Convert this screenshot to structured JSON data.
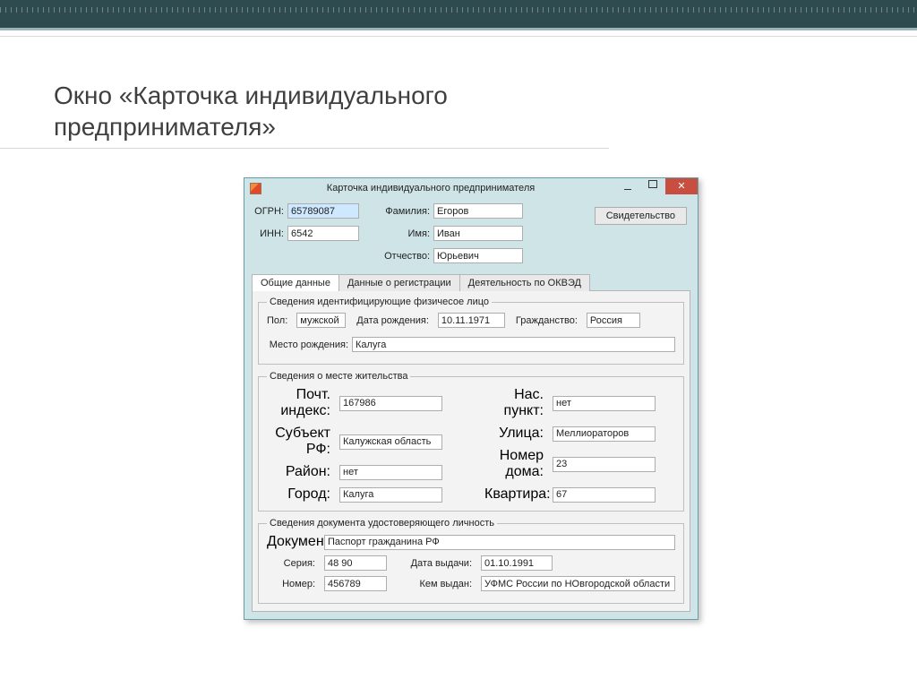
{
  "slide": {
    "title": "Окно «Карточка индивидуального предпринимателя»"
  },
  "window": {
    "title": "Карточка индивидуального предпринимателя",
    "header": {
      "ogrn_label": "ОГРН:",
      "ogrn_value": "65789087",
      "inn_label": "ИНН:",
      "inn_value": "6542",
      "lastname_label": "Фамилия:",
      "lastname_value": "Егоров",
      "firstname_label": "Имя:",
      "firstname_value": "Иван",
      "patronymic_label": "Отчество:",
      "patronymic_value": "Юрьевич",
      "cert_button": "Свидетельство"
    },
    "tabs": {
      "tab1": "Общие данные",
      "tab2": "Данные о регистрации",
      "tab3": "Деятельность по ОКВЭД"
    },
    "identity": {
      "legend": "Сведения идентифицирующие физичесое лицо",
      "gender_label": "Пол:",
      "gender_value": "мужской",
      "dob_label": "Дата рождения:",
      "dob_value": "10.11.1971",
      "citizenship_label": "Гражданство:",
      "citizenship_value": "Россия",
      "birthplace_label": "Место рождения:",
      "birthplace_value": "Калуга"
    },
    "residence": {
      "legend": "Сведения о месте жительства",
      "postcode_label": "Почт. индекс:",
      "postcode_value": "167986",
      "subject_label": "Субъект РФ:",
      "subject_value": "Калужская область",
      "district_label": "Район:",
      "district_value": "нет",
      "city_label": "Город:",
      "city_value": "Калуга",
      "settlement_label": "Нас. пункт:",
      "settlement_value": "нет",
      "street_label": "Улица:",
      "street_value": "Меллиораторов",
      "house_label": "Номер дома:",
      "house_value": "23",
      "flat_label": "Квартира:",
      "flat_value": "67"
    },
    "document": {
      "legend": "Сведения документа удостоверяющего личность",
      "doc_label": "Документ:",
      "doc_value": "Паспорт гражданина РФ",
      "series_label": "Серия:",
      "series_value": "48 90",
      "issue_date_label": "Дата выдачи:",
      "issue_date_value": "01.10.1991",
      "number_label": "Номер:",
      "number_value": "456789",
      "issuer_label": "Кем выдан:",
      "issuer_value": "УФМС России по НОвгородской области"
    }
  }
}
